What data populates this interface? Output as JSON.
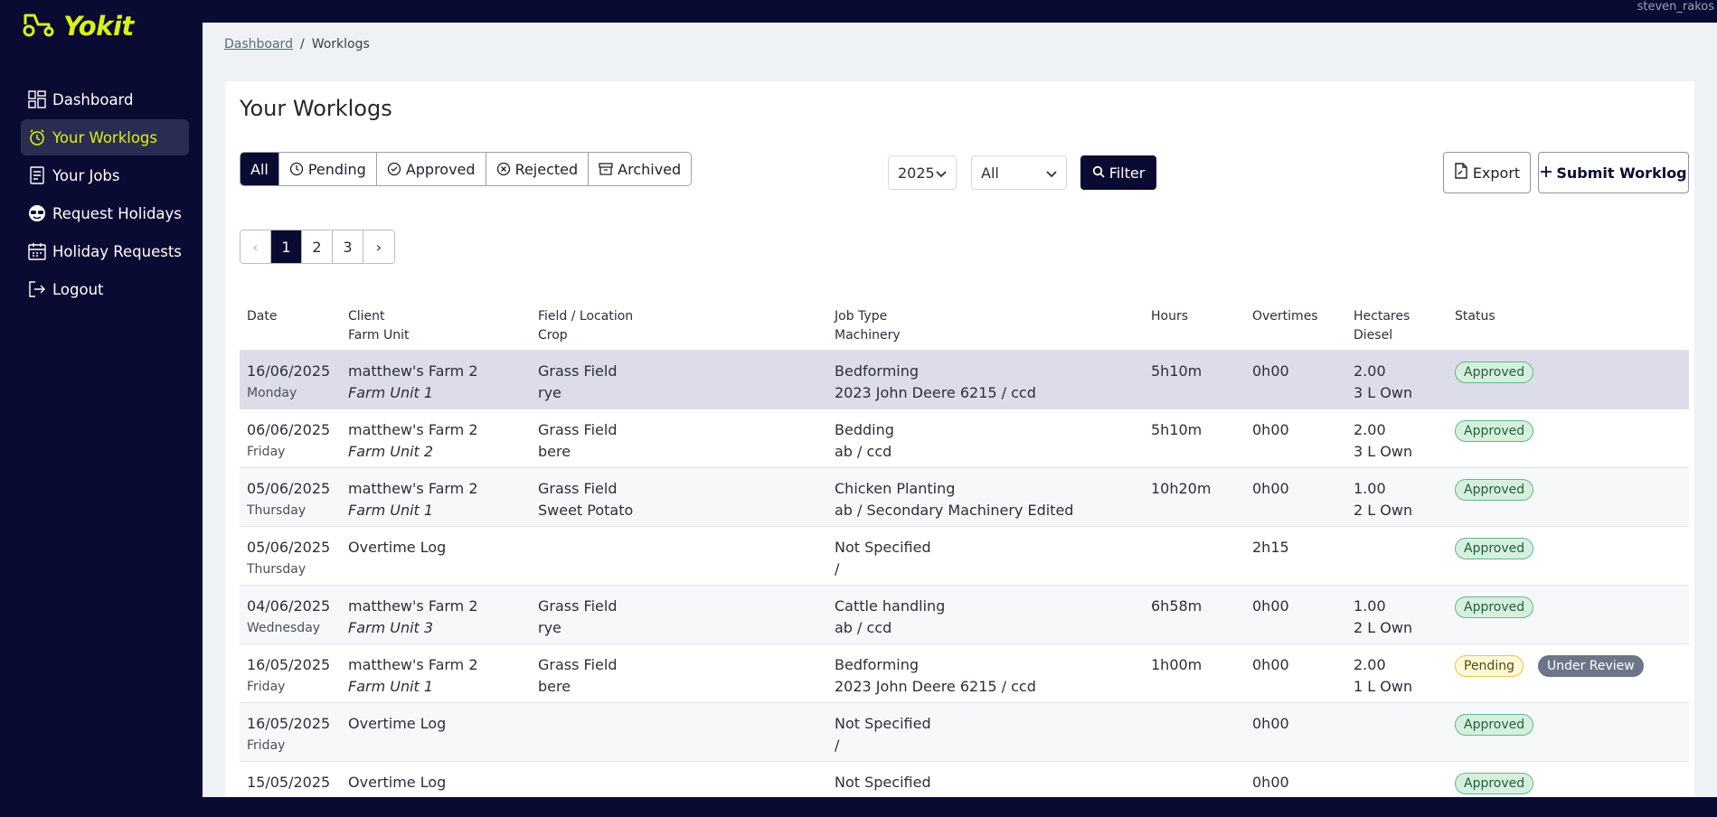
{
  "app": {
    "name": "Yokit",
    "username": "steven_rakos"
  },
  "sidebar": {
    "items": [
      {
        "label": "Dashboard",
        "icon": "dashboard-icon",
        "active": false
      },
      {
        "label": "Your Worklogs",
        "icon": "clock-icon",
        "active": true
      },
      {
        "label": "Your Jobs",
        "icon": "list-icon",
        "active": false
      },
      {
        "label": "Request Holidays",
        "icon": "sunglasses-icon",
        "active": false
      },
      {
        "label": "Holiday Requests",
        "icon": "calendar-icon",
        "active": false
      },
      {
        "label": "Logout",
        "icon": "logout-icon",
        "active": false
      }
    ]
  },
  "breadcrumb": {
    "parent": "Dashboard",
    "separator": "/",
    "current": "Worklogs"
  },
  "page": {
    "title": "Your Worklogs"
  },
  "tabs": [
    {
      "label": "All",
      "icon": "",
      "active": true
    },
    {
      "label": "Pending",
      "icon": "clock-icon",
      "active": false
    },
    {
      "label": "Approved",
      "icon": "check-circle-icon",
      "active": false
    },
    {
      "label": "Rejected",
      "icon": "x-circle-icon",
      "active": false
    },
    {
      "label": "Archived",
      "icon": "archive-icon",
      "active": false
    }
  ],
  "filters": {
    "year": "2025",
    "type": "All",
    "filter_label": "Filter"
  },
  "actions": {
    "export_label": "Export",
    "submit_label": "Submit Worklog"
  },
  "pagination": {
    "prev": "‹",
    "pages": [
      "1",
      "2",
      "3"
    ],
    "current": "1",
    "next": "›"
  },
  "table": {
    "headers": {
      "date": "Date",
      "client": "Client",
      "farm_unit": "Farm Unit",
      "field": "Field / Location",
      "crop": "Crop",
      "job_type": "Job Type",
      "machinery": "Machinery",
      "hours": "Hours",
      "overtimes": "Overtimes",
      "hectares": "Hectares",
      "diesel": "Diesel",
      "status": "Status"
    },
    "rows": [
      {
        "date": "16/06/2025",
        "day": "Monday",
        "client": "matthew's Farm 2",
        "farm_unit": "Farm Unit 1",
        "field": "Grass Field",
        "crop": "rye",
        "job_type": "Bedforming",
        "machinery": "2023 John Deere 6215 / ccd",
        "hours": "5h10m",
        "overtimes": "0h00",
        "hectares": "2.00",
        "diesel": "3 L Own",
        "status": "Approved",
        "extra": ""
      },
      {
        "date": "06/06/2025",
        "day": "Friday",
        "client": "matthew's Farm 2",
        "farm_unit": "Farm Unit 2",
        "field": "Grass Field",
        "crop": "bere",
        "job_type": "Bedding",
        "machinery": "ab / ccd",
        "hours": "5h10m",
        "overtimes": "0h00",
        "hectares": "2.00",
        "diesel": "3 L Own",
        "status": "Approved",
        "extra": ""
      },
      {
        "date": "05/06/2025",
        "day": "Thursday",
        "client": "matthew's Farm 2",
        "farm_unit": "Farm Unit 1",
        "field": "Grass Field",
        "crop": "Sweet Potato",
        "job_type": "Chicken Planting",
        "machinery": "ab / Secondary Machinery Edited",
        "hours": "10h20m",
        "overtimes": "0h00",
        "hectares": "1.00",
        "diesel": "2 L Own",
        "status": "Approved",
        "extra": ""
      },
      {
        "date": "05/06/2025",
        "day": "Thursday",
        "client": "Overtime Log",
        "farm_unit": "",
        "field": "",
        "crop": "",
        "job_type": "Not Specified",
        "machinery": "/",
        "hours": "",
        "overtimes": "2h15",
        "hectares": "",
        "diesel": "",
        "status": "Approved",
        "extra": ""
      },
      {
        "date": "04/06/2025",
        "day": "Wednesday",
        "client": "matthew's Farm 2",
        "farm_unit": "Farm Unit 3",
        "field": "Grass Field",
        "crop": "rye",
        "job_type": "Cattle handling",
        "machinery": "ab / ccd",
        "hours": "6h58m",
        "overtimes": "0h00",
        "hectares": "1.00",
        "diesel": "2 L Own",
        "status": "Approved",
        "extra": ""
      },
      {
        "date": "16/05/2025",
        "day": "Friday",
        "client": "matthew's Farm 2",
        "farm_unit": "Farm Unit 1",
        "field": "Grass Field",
        "crop": "bere",
        "job_type": "Bedforming",
        "machinery": "2023 John Deere 6215 / ccd",
        "hours": "1h00m",
        "overtimes": "0h00",
        "hectares": "2.00",
        "diesel": "1 L Own",
        "status": "Pending",
        "extra": "Under Review"
      },
      {
        "date": "16/05/2025",
        "day": "Friday",
        "client": "Overtime Log",
        "farm_unit": "",
        "field": "",
        "crop": "",
        "job_type": "Not Specified",
        "machinery": "/",
        "hours": "",
        "overtimes": "0h00",
        "hectares": "",
        "diesel": "",
        "status": "Approved",
        "extra": ""
      },
      {
        "date": "15/05/2025",
        "day": "",
        "client": "Overtime Log",
        "farm_unit": "",
        "field": "",
        "crop": "",
        "job_type": "Not Specified",
        "machinery": "",
        "hours": "",
        "overtimes": "0h00",
        "hectares": "",
        "diesel": "",
        "status": "Approved",
        "extra": ""
      }
    ]
  },
  "colors": {
    "brand": "#d7f218",
    "navy": "#0a0b33"
  }
}
